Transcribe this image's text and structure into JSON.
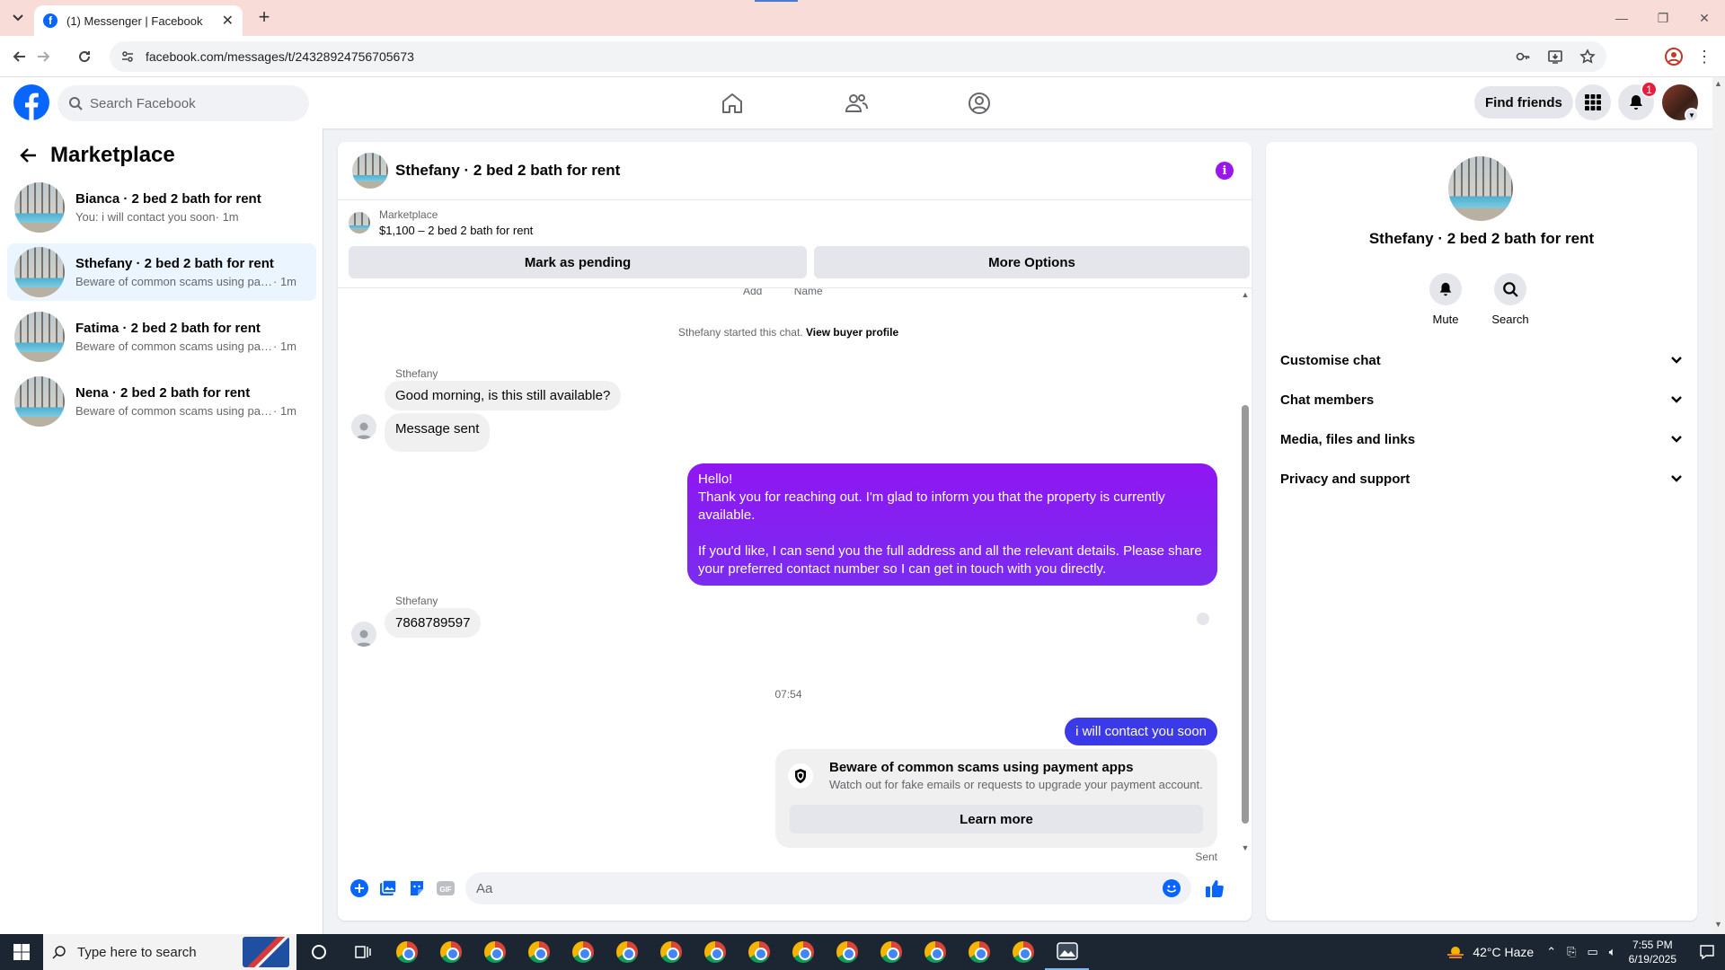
{
  "browser": {
    "tab_title": "(1) Messenger | Facebook",
    "url": "facebook.com/messages/t/24328924756705673",
    "favicon_letter": "f"
  },
  "fbnav": {
    "search_placeholder": "Search Facebook",
    "find_friends_label": "Find friends",
    "notification_count": "1",
    "brand_color": "#0866ff"
  },
  "sidebar": {
    "title": "Marketplace",
    "conversations": [
      {
        "name": "Bianca · 2 bed 2 bath for rent",
        "snippet": "You: i will contact you soon",
        "time": "· 1m"
      },
      {
        "name": "Sthefany · 2 bed 2 bath for rent",
        "snippet": "Beware of common scams using pay...",
        "time": "· 1m"
      },
      {
        "name": "Fatima · 2 bed 2 bath for rent",
        "snippet": "Beware of common scams using pay...",
        "time": "· 1m"
      },
      {
        "name": "Nena · 2 bed 2 bath for rent",
        "snippet": "Beware of common scams using pay...",
        "time": "· 1m"
      }
    ]
  },
  "chat": {
    "title": "Sthefany · 2 bed 2 bath for rent",
    "listing_source": "Marketplace",
    "listing_price": "$1,100 – 2 bed 2 bath for rent",
    "mark_pending_label": "Mark as pending",
    "more_options_label": "More Options",
    "clipped_labels": [
      "Add",
      "Name"
    ],
    "started_text": "Sthefany started this chat.",
    "view_profile_label": "View buyer profile",
    "messages": [
      {
        "sender": "Sthefany",
        "text": "Good morning, is this still available?"
      },
      {
        "text": "Message sent"
      },
      {
        "outgoing": true,
        "lines": [
          "Hello!",
          "Thank you for reaching out. I'm glad to inform you that the property is currently available.",
          "",
          "If you'd like, I can send you the full address and all the relevant details. Please share your preferred contact number so I can get in touch with you directly."
        ]
      },
      {
        "sender": "Sthefany",
        "text": "7868789597"
      },
      {
        "outgoing": true,
        "text": "i will contact you soon"
      }
    ],
    "time_separator": "07:54",
    "scam_title": "Beware of common scams using payment apps",
    "scam_subtitle": "Watch out for fake emails or requests to upgrade your payment account.",
    "learn_more_label": "Learn more",
    "sent_label": "Sent",
    "composer_placeholder": "Aa",
    "outgoing_color": "#8a12f3",
    "outgoing_color_2": "#3a3ae8"
  },
  "info": {
    "name": "Sthefany · 2 bed 2 bath for rent",
    "actions": [
      "Mute",
      "Search"
    ],
    "sections": [
      "Customise chat",
      "Chat members",
      "Media, files and links",
      "Privacy and support"
    ]
  },
  "taskbar": {
    "search_placeholder": "Type here to search",
    "weather": "42°C  Haze",
    "time": "7:55 PM",
    "date": "6/19/2025"
  }
}
